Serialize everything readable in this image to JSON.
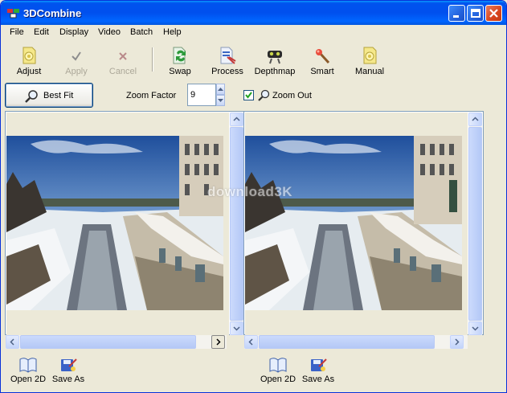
{
  "window": {
    "title": "3DCombine",
    "controls": {
      "minimize": "minimize-icon",
      "maximize": "maximize-icon",
      "close": "close-icon"
    }
  },
  "menu": [
    "File",
    "Edit",
    "Display",
    "Video",
    "Batch",
    "Help"
  ],
  "toolbar": {
    "adjust": "Adjust",
    "apply": "Apply",
    "cancel": "Cancel",
    "swap": "Swap",
    "process": "Process",
    "depthmap": "Depthmap",
    "smart": "Smart",
    "manual": "Manual"
  },
  "viewbar": {
    "best_fit": "Best Fit",
    "zoom_factor_label": "Zoom Factor",
    "zoom_factor_value": "9",
    "zoom_out_label": "Zoom Out",
    "zoom_out_checked": true
  },
  "left_panel": {
    "open_label": "Open 2D",
    "save_label": "Save As"
  },
  "right_panel": {
    "open_label": "Open 2D",
    "save_label": "Save As"
  },
  "watermark": "download3K",
  "colors": {
    "titlebar": "#0053ee",
    "face": "#ece9d8",
    "scrollbar": "#c3d4fa"
  }
}
